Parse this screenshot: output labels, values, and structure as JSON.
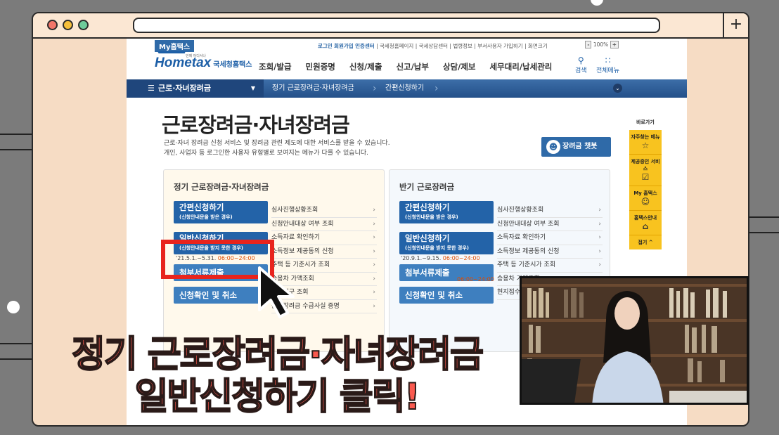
{
  "site": {
    "my_tab": "My홈택스",
    "util_links": [
      "로그인",
      "회원가입",
      "인증센터",
      "국세청홈페이지",
      "국세상담센터",
      "법령정보",
      "부서사용자 가입하기",
      "화면크기"
    ],
    "zoom": "100%",
    "logo_text": "Hometax",
    "logo_kr": "국세청홈택스",
    "logo_sub": "언제 어디서나",
    "menu": [
      "조회/발급",
      "민원증명",
      "신청/제출",
      "신고/납부",
      "상담/제보",
      "세무대리/납세관리"
    ],
    "search_label": "검색",
    "allmenu_label": "전체메뉴"
  },
  "breadcrumb": {
    "first": "근로·자녀장려금",
    "second": "정기 근로장려금·자녀장려금",
    "third": "간편신청하기"
  },
  "page": {
    "title": "근로장려금·자녀장려금",
    "desc_line1": "근로·자녀 장려금 신청 서비스 및 장려금 관련 제도에 대한 서비스를 받을 수 있습니다.",
    "desc_line2": "개인, 사업자 등 로그인한 사용자 유형별로 보여지는 메뉴가 다를 수 있습니다.",
    "chatbot": "장려금 챗봇"
  },
  "left_panel": {
    "title": "정기 근로장려금·자녀장려금",
    "buttons": [
      {
        "label": "간편신청하기",
        "sub": "(신청안내문을 받은 경우)"
      },
      {
        "label": "일반신청하기",
        "sub": "(신청안내문을 받지 못한 경우)"
      },
      {
        "label": "첨부서류제출",
        "sub": ""
      },
      {
        "label": "신청확인 및 취소",
        "sub": ""
      }
    ],
    "links": [
      "심사진행상황조회",
      "신청안내대상 여부 조회",
      "소득자료 확인하기",
      "소득정보 제공동의 신청",
      "주택 등 기준시가 조회",
      "승용차 가액조회",
      "경정청구 조회",
      "근로장려금 수급사실 증명"
    ],
    "date_a": "'21.5.1.~5.31.",
    "time_a": "06:00~24:00"
  },
  "right_panel": {
    "title": "반기 근로장려금",
    "buttons": [
      {
        "label": "간편신청하기",
        "sub": "(신청안내문을 받은 경우)"
      },
      {
        "label": "일반신청하기",
        "sub": "(신청안내문을 받지 못한 경우)"
      },
      {
        "label": "첨부서류제출",
        "sub": ""
      },
      {
        "label": "신청확인 및 취소",
        "sub": ""
      }
    ],
    "links": [
      "심사진행상황조회",
      "신청안내대상 여부 조회",
      "소득자료 확인하기",
      "소득정보 제공동의 신청",
      "주택 등 기준시가 조회",
      "승용차 가액조회",
      "현지접수"
    ],
    "date_a": "'20.9.1.~9.15.",
    "time_a": "06:00~24:00",
    "time_b": "06:00~24:00"
  },
  "quick_menu": {
    "label": "바로가기",
    "items": [
      "자주찾는 메뉴",
      "제공중인 서비스",
      "My 홈택스",
      "홈택스안내"
    ],
    "fold": "접기 ^"
  },
  "captions": {
    "line1": "정기 근로장려금·자녀장려금",
    "line2": "일반신청하기 클릭!"
  },
  "colors": {
    "brand_blue": "#2363a8",
    "highlight_red": "#e8241d",
    "caption_red": "#fa5a4f",
    "frame_beige": "#f6dcc4",
    "quick_yellow": "#f8c31f"
  }
}
